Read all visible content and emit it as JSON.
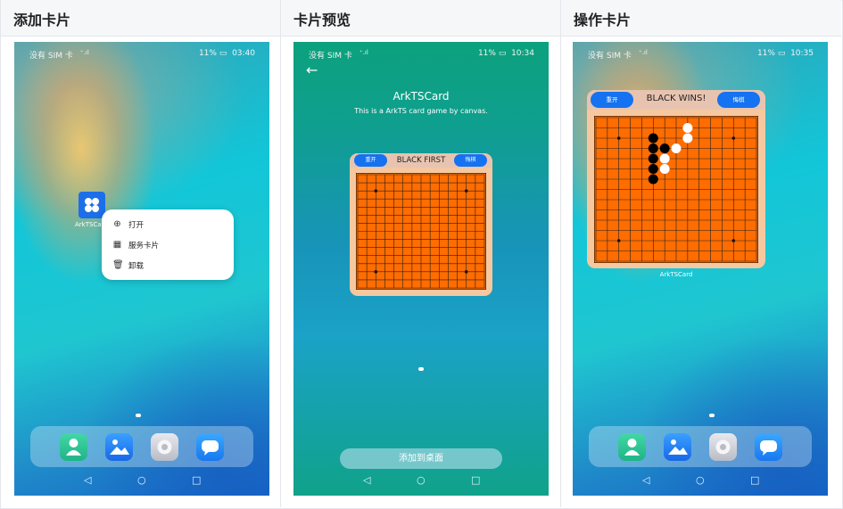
{
  "columns": [
    {
      "title": "添加卡片"
    },
    {
      "title": "卡片预览"
    },
    {
      "title": "操作卡片"
    }
  ],
  "status": {
    "carrier": "没有 SIM 卡",
    "battery": "11%",
    "time1": "03:40",
    "time2": "10:34",
    "time3": "10:35"
  },
  "panel1": {
    "app_label": "ArkTSCard",
    "menu": [
      {
        "icon": "plus-circle-icon",
        "label": "打开"
      },
      {
        "icon": "grid-icon",
        "label": "服务卡片"
      },
      {
        "icon": "trash-icon",
        "label": "卸载"
      }
    ]
  },
  "panel2": {
    "title": "ArkTSCard",
    "subtitle": "This is a ArkTS card game by canvas.",
    "card": {
      "restart": "重开",
      "status": "BLACK FIRST",
      "undo": "悔棋"
    },
    "add_button": "添加到桌面"
  },
  "panel3": {
    "card": {
      "restart": "重开",
      "status": "BLACK WINS!",
      "undo": "悔棋"
    },
    "card_label": "ArkTSCard",
    "black_stones": [
      [
        5,
        2
      ],
      [
        5,
        3
      ],
      [
        6,
        3
      ],
      [
        5,
        4
      ],
      [
        5,
        5
      ],
      [
        5,
        6
      ]
    ],
    "white_stones": [
      [
        8,
        1
      ],
      [
        8,
        2
      ],
      [
        7,
        3
      ],
      [
        6,
        4
      ],
      [
        6,
        5
      ]
    ]
  },
  "board": {
    "lines": 15,
    "star_points": [
      [
        2,
        2
      ],
      [
        12,
        2
      ],
      [
        2,
        12
      ],
      [
        12,
        12
      ]
    ]
  },
  "dock_apps": [
    "contacts-icon",
    "gallery-icon",
    "settings-icon",
    "messages-icon"
  ],
  "colors": {
    "board": "#ff6c00",
    "button": "#1572f0",
    "card_bg": "#f5c8a0"
  }
}
